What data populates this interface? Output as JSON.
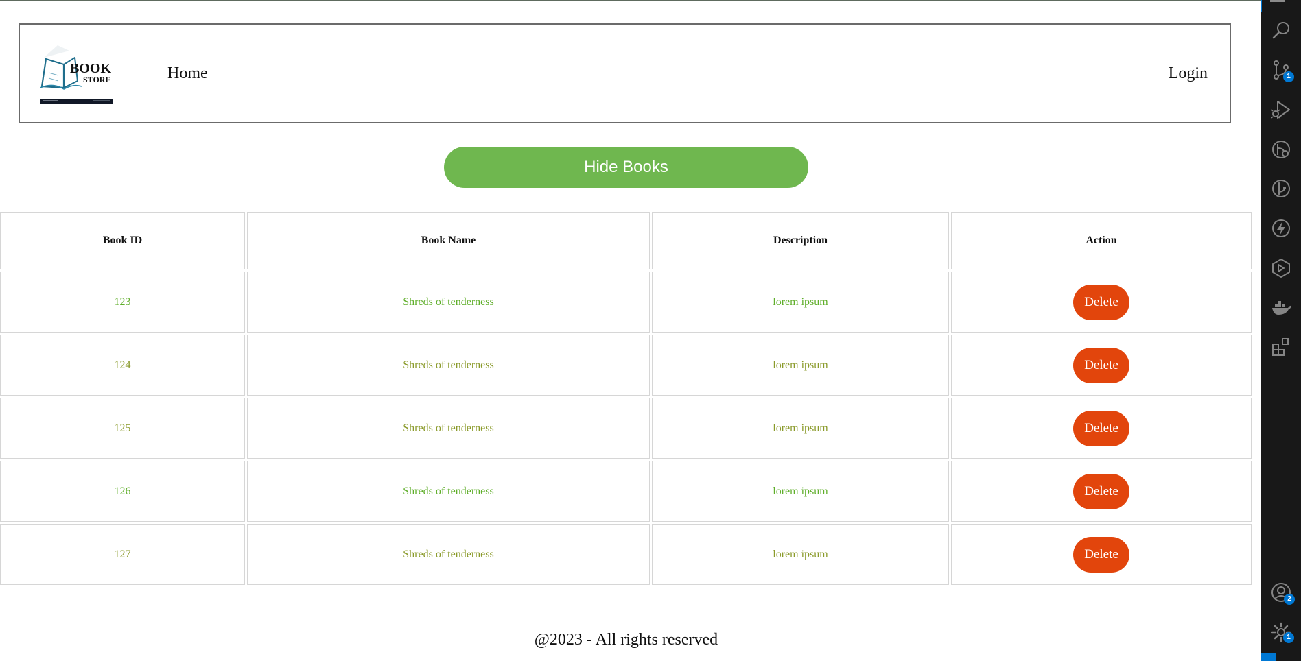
{
  "header": {
    "logo": {
      "line1": "BOOK",
      "line2": "STORE"
    },
    "nav_home": "Home",
    "nav_login": "Login"
  },
  "toggle_button_label": "Hide Books",
  "table": {
    "headers": [
      "Book ID",
      "Book Name",
      "Description",
      "Action"
    ],
    "rows": [
      {
        "id": "123",
        "name": "Shreds of tenderness",
        "description": "lorem ipsum",
        "action": "Delete"
      },
      {
        "id": "124",
        "name": "Shreds of tenderness",
        "description": "lorem ipsum",
        "action": "Delete"
      },
      {
        "id": "125",
        "name": "Shreds of tenderness",
        "description": "lorem ipsum",
        "action": "Delete"
      },
      {
        "id": "126",
        "name": "Shreds of tenderness",
        "description": "lorem ipsum",
        "action": "Delete"
      },
      {
        "id": "127",
        "name": "Shreds of tenderness",
        "description": "lorem ipsum",
        "action": "Delete"
      }
    ]
  },
  "footer_text": "@2023 - All rights reserved",
  "activity_bar": {
    "icons": [
      "search-icon",
      "source-control-icon",
      "run-debug-icon",
      "git-graph-icon",
      "github-icon",
      "lightning-icon",
      "remote-explorer-icon",
      "docker-icon",
      "extensions-icon",
      "accounts-icon",
      "settings-gear-icon"
    ],
    "badges": {
      "source_control": "1",
      "accounts": "2",
      "settings": "1"
    }
  },
  "colors": {
    "accent_green": "#6fb74f",
    "delete_red": "#e2450c",
    "text_green_a": "#5fae2a",
    "text_green_b": "#8a9a2a",
    "activity_bg": "#181818",
    "badge_blue": "#0078d4"
  }
}
